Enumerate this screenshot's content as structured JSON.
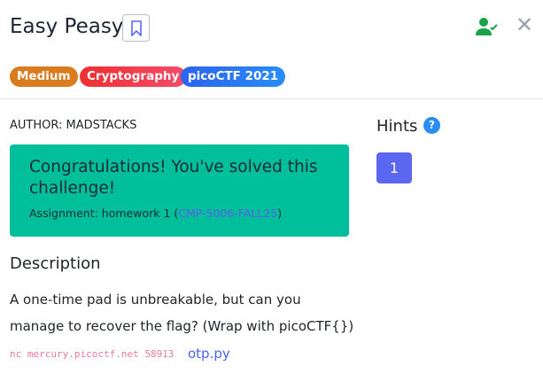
{
  "title": "Easy Peasy",
  "tags": [
    "Medium",
    "Cryptography",
    "picoCTF 2021"
  ],
  "author": "AUTHOR: MADSTACKS",
  "solved": {
    "message": "Congratulations! You've solved this challenge!",
    "assignment_prefix": "Assignment: homework 1 (",
    "assignment_link": "CMP-5006-FALL25",
    "assignment_suffix": ")"
  },
  "description": {
    "heading": "Description",
    "text": "A one-time pad is unbreakable, but can you manage to recover the flag? (Wrap with picoCTF{})",
    "command": "nc mercury.picoctf.net 58913",
    "file_link": "otp.py"
  },
  "hints": {
    "heading": "Hints",
    "help": "?",
    "items": [
      "1"
    ]
  },
  "close": "✕"
}
